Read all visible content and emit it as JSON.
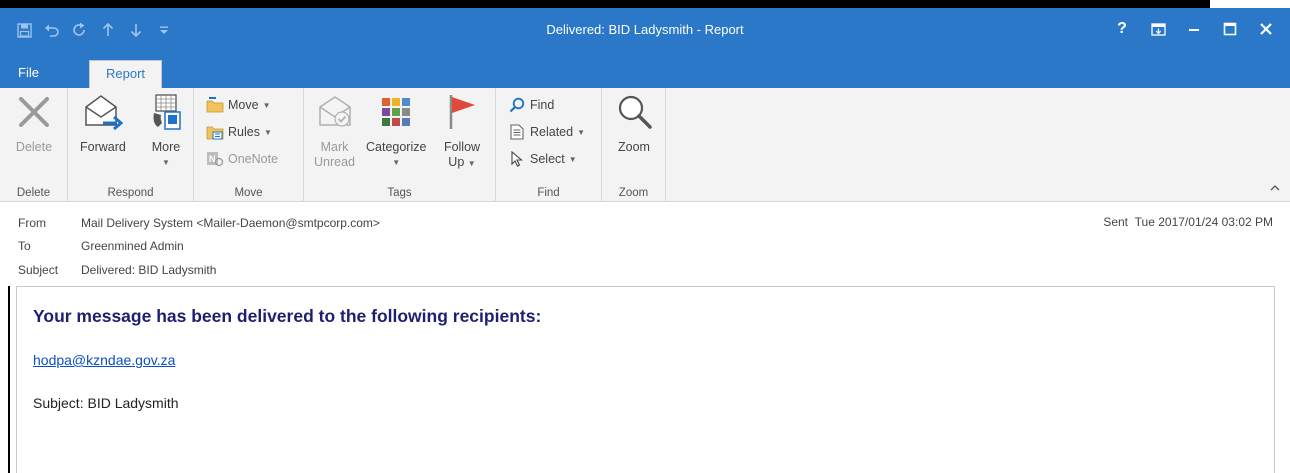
{
  "window": {
    "title": "Delivered: BID Ladysmith - Report",
    "accent_color": "#2b78c9",
    "controls": {
      "help": "?",
      "ribbon_options": "⧉",
      "minimize": "–",
      "maximize": "☐",
      "close": "✕"
    }
  },
  "qat": [
    {
      "name": "save-icon"
    },
    {
      "name": "undo-icon"
    },
    {
      "name": "redo-icon"
    },
    {
      "name": "previous-item-icon"
    },
    {
      "name": "next-item-icon"
    },
    {
      "name": "customize-qat-icon"
    }
  ],
  "tabs": [
    {
      "label": "File",
      "active": false
    },
    {
      "label": "Report",
      "active": true
    }
  ],
  "ribbon": {
    "groups": {
      "delete": {
        "label": "Delete",
        "buttons": {
          "delete": "Delete"
        }
      },
      "respond": {
        "label": "Respond",
        "buttons": {
          "forward": "Forward",
          "more": "More"
        }
      },
      "move": {
        "label": "Move",
        "buttons": {
          "move": "Move",
          "rules": "Rules",
          "onenote": "OneNote"
        }
      },
      "tags": {
        "label": "Tags",
        "buttons": {
          "mark_line1": "Mark",
          "mark_line2": "Unread",
          "categorize": "Categorize",
          "follow_line1": "Follow",
          "follow_line2": "Up"
        }
      },
      "find": {
        "label": "Find",
        "buttons": {
          "find": "Find",
          "related": "Related",
          "select": "Select"
        }
      },
      "zoom": {
        "label": "Zoom",
        "buttons": {
          "zoom": "Zoom"
        }
      }
    }
  },
  "header": {
    "from_label": "From",
    "from_value": "Mail Delivery System <Mailer-Daemon@smtpcorp.com>",
    "to_label": "To",
    "to_value": "Greenmined Admin",
    "subject_label": "Subject",
    "subject_value": "Delivered: BID Ladysmith",
    "sent_label": "Sent",
    "sent_value": "Tue 2017/01/24 03:02 PM"
  },
  "message": {
    "heading": "Your message has been delivered to the following recipients:",
    "recipient": "hodpa@kzndae.gov.za",
    "subject_line": "Subject: BID Ladysmith"
  }
}
